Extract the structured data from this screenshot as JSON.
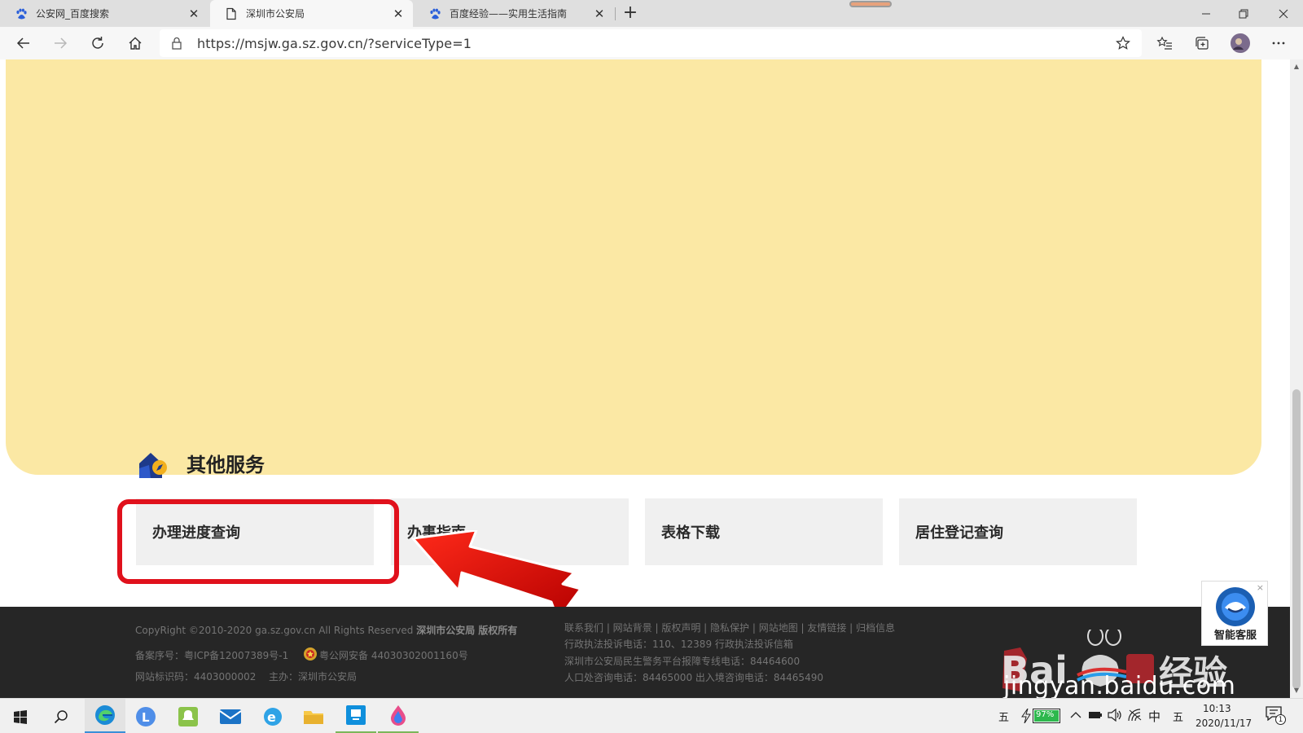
{
  "browser": {
    "tabs": [
      {
        "label": "公安网_百度搜索",
        "icon": "baidu-paw-icon",
        "active": false
      },
      {
        "label": "深圳市公安局",
        "icon": "page-icon",
        "active": true
      },
      {
        "label": "百度经验——实用生活指南",
        "icon": "baidu-paw-icon",
        "active": false
      }
    ],
    "new_tab": "+",
    "url": "https://msjw.ga.sz.gov.cn/?serviceType=1"
  },
  "page": {
    "section_title": "其他服务",
    "services": [
      {
        "label": "办理进度查询",
        "highlighted": true
      },
      {
        "label": "办事指南"
      },
      {
        "label": "表格下载"
      },
      {
        "label": "居住登记查询"
      }
    ],
    "footer": {
      "copyright": "CopyRight ©2010-2020 ga.sz.gov.cn All Rights Reserved",
      "owner": "深圳市公安局 版权所有",
      "icp": "备案序号：粤ICP备12007389号-1",
      "police_record": "粤公网安备 44030302001160号",
      "site_id": "网站标识码：4403000002",
      "host": "主办：深圳市公安局",
      "links": "联系我们 | 网站背景 | 版权声明 | 隐私保护 | 网站地图 | 友情链接 | 归档信息",
      "complaint_line": "行政执法投诉电话：110、12389   行政执法投诉信箱",
      "hotline": "深圳市公安局民生警务平台报障专线电话：84464600",
      "consult": "人口处咨询电话：84465000 出入境咨询电话：84465490"
    },
    "customer_service": {
      "label": "智能客服",
      "close": "×"
    },
    "watermark": {
      "brand": "Bai经验",
      "url": "jingyan.baidu.com"
    }
  },
  "taskbar": {
    "ime_left": "五",
    "battery": "97%",
    "ime_lang": "中",
    "ime_right": "五",
    "time": "10:13",
    "date": "2020/11/17",
    "notification_count": "1"
  },
  "colors": {
    "yellow_panel": "#fbe8a4",
    "highlight_red": "#e0111c",
    "footer_bg": "#262626",
    "service_tile": "#f0f0f0"
  }
}
